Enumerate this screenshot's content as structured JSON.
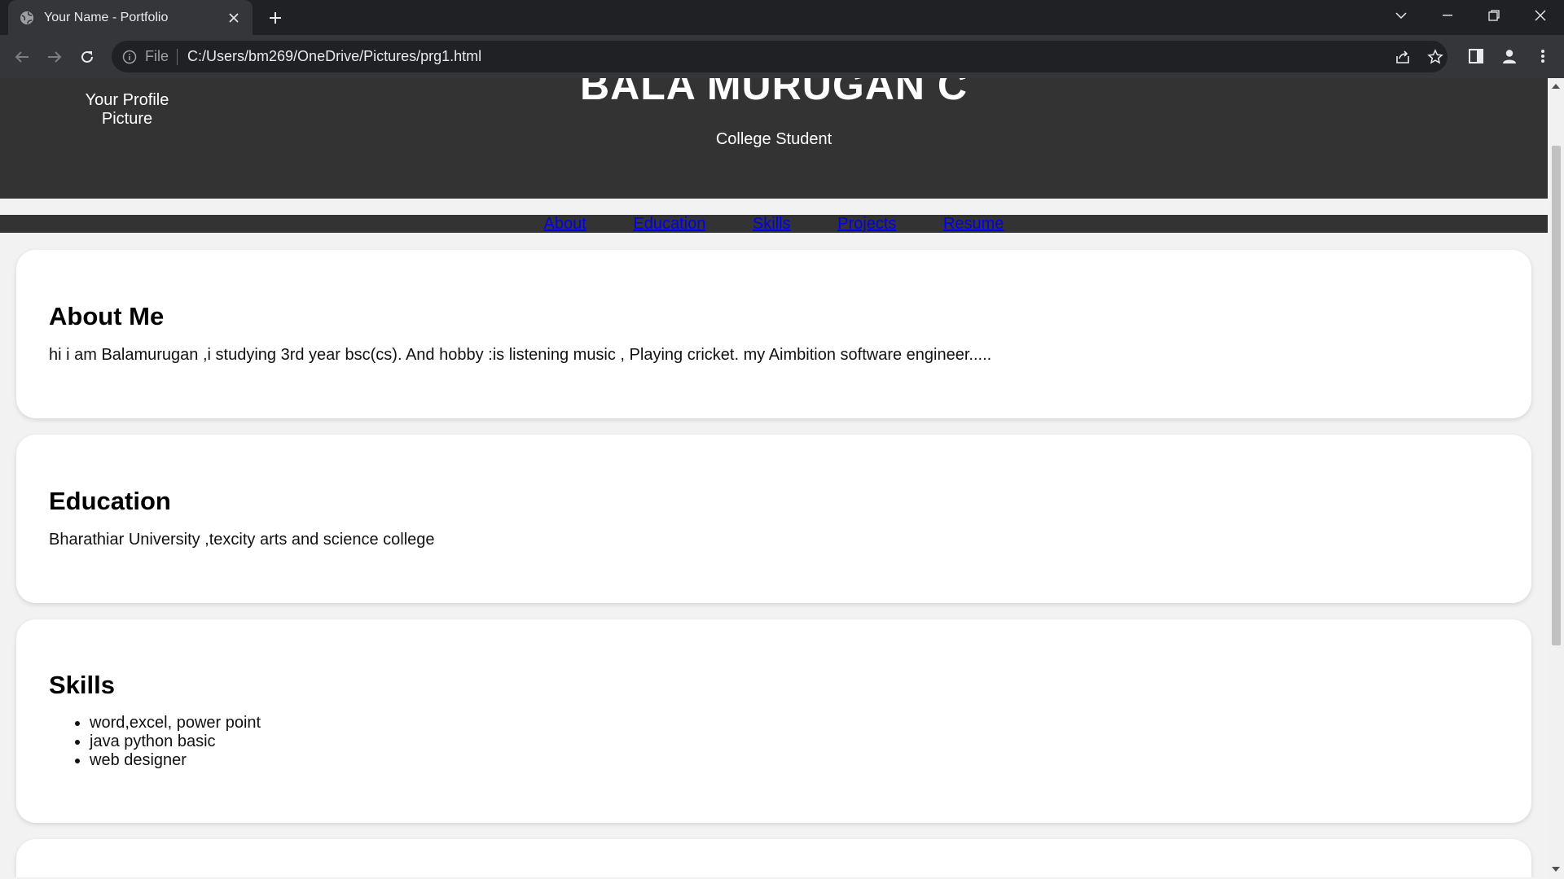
{
  "browser": {
    "tab_title": "Your Name - Portfolio",
    "omnibox_scheme": "File",
    "url": "C:/Users/bm269/OneDrive/Pictures/prg1.html",
    "icons": [
      "globe-icon",
      "close-icon",
      "plus-icon",
      "chevron-down-icon",
      "minimize-icon",
      "restore-icon",
      "window-close-icon",
      "back-icon",
      "forward-icon",
      "reload-icon",
      "info-icon",
      "share-icon",
      "star-icon",
      "sidepanel-icon",
      "profile-icon",
      "menu-icon"
    ]
  },
  "header": {
    "profile_alt": "Your Profile Picture",
    "name": "BALA MURUGAN C",
    "role": "College Student"
  },
  "nav": {
    "items": [
      "About",
      "Education",
      "Skills",
      "Projects",
      "Resume"
    ]
  },
  "about": {
    "title": "About Me",
    "text": "hi i am Balamurugan ,i studying 3rd year bsc(cs). And hobby :is listening music , Playing cricket. my Aimbition software engineer....."
  },
  "education": {
    "title": "Education",
    "text": "Bharathiar University ,texcity arts and science college"
  },
  "skills": {
    "title": "Skills",
    "items": [
      "word,excel, power point",
      "java python basic",
      "web designer"
    ]
  },
  "colors": {
    "header_bg": "#333333",
    "link": "#0000ee",
    "page_bg": "#f2f2f2",
    "card_bg": "#ffffff"
  }
}
